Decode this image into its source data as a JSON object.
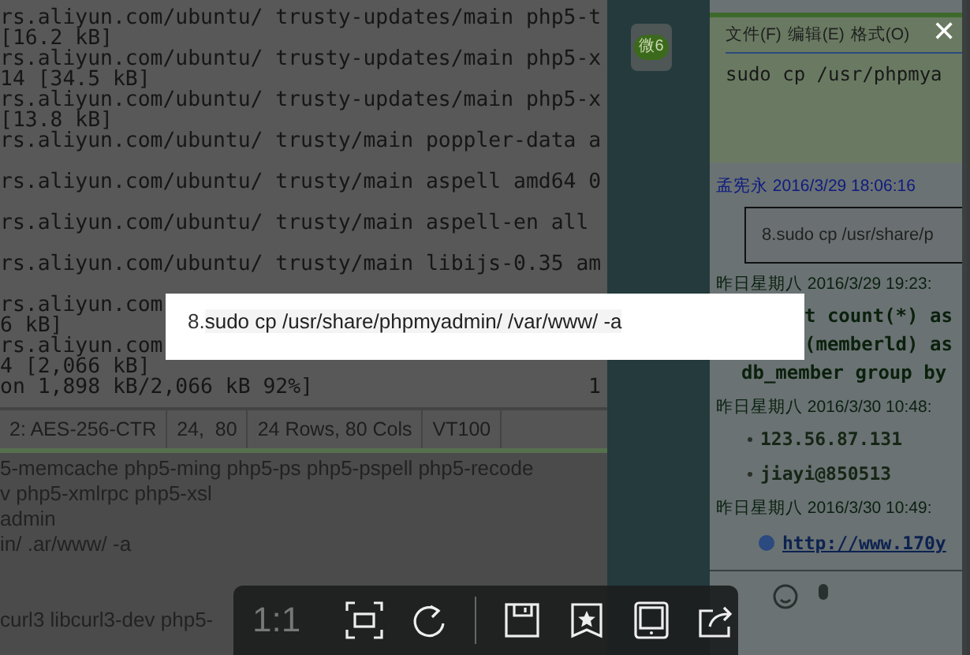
{
  "terminal": {
    "blocks": [
      [
        "rs.aliyun.com/ubuntu/ trusty-updates/main php5-t",
        "[16.2 kB]",
        "rs.aliyun.com/ubuntu/ trusty-updates/main php5-x",
        "14 [34.5 kB]",
        "rs.aliyun.com/ubuntu/ trusty-updates/main php5-x",
        "[13.8 kB]",
        "rs.aliyun.com/ubuntu/ trusty/main poppler-data a"
      ],
      [
        "rs.aliyun.com/ubuntu/ trusty/main aspell amd64 0"
      ],
      [
        "rs.aliyun.com/ubuntu/ trusty/main aspell-en all"
      ],
      [
        "rs.aliyun.com/ubuntu/ trusty/main libijs-0.35 am"
      ],
      [
        "rs.aliyun.com",
        "6 kB]",
        "rs.aliyun.com",
        "4 [2,066 kB]",
        "on 1,898 kB/2,066 kB 92%]"
      ]
    ],
    "line_end": "1",
    "status_bar": [
      "2: AES-256-CTR",
      "24,  80",
      "24 Rows, 80 Cols",
      "VT100"
    ]
  },
  "terminal_lower": {
    "lines": [
      "5-memcache php5-ming php5-ps php5-pspell php5-recode",
      "v php5-xmlrpc php5-xsl",
      "admin",
      "in/ .ar/www/ -a"
    ],
    "bottom_line": "curl3 libcurl3-dev php5-"
  },
  "sidebar": {
    "badge": "微6"
  },
  "chat": {
    "menu": [
      "文件(F)",
      "编辑(E)",
      "格式(O)"
    ],
    "input_text": "sudo cp /usr/phpmya",
    "items": [
      {
        "kind": "header",
        "text": "孟宪永 2016/3/29 18:06:16",
        "color": "#0e1a80"
      },
      {
        "kind": "quote",
        "number": "8.",
        "text": "sudo cp /usr/share/p"
      },
      {
        "kind": "header",
        "text": "昨日星期八 2016/3/29 19:23:",
        "color": "#0a2010"
      },
      {
        "kind": "code",
        "lines": [
          "t count(*) as",
          "(memberld) as",
          "db_member group by"
        ]
      },
      {
        "kind": "header",
        "text": "昨日星期八 2016/3/30 10:48:",
        "color": "#0a2010"
      },
      {
        "kind": "bullet",
        "text": "123.56.87.131"
      },
      {
        "kind": "bullet",
        "text": "jiayi@850513"
      },
      {
        "kind": "header",
        "text": "昨日星期八 2016/3/30 10:49:",
        "color": "#0a2010"
      },
      {
        "kind": "link",
        "text": "http://www.170y"
      }
    ]
  },
  "popup": {
    "number": "8.",
    "text": "sudo cp /usr/share/phpmyadmin/ /var/www/ -a"
  },
  "viewer_toolbar": {
    "zoom_label": "1:1"
  },
  "close_button": {
    "label": "✕"
  }
}
